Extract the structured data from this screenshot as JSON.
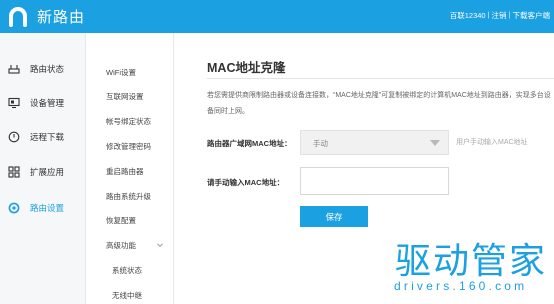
{
  "header": {
    "brand": "新路由",
    "links": [
      "百联12340",
      "注销",
      "下载客户端"
    ],
    "separator": "|",
    "accent": "#1ba0e2"
  },
  "sidebar": {
    "items": [
      {
        "label": "路由状态",
        "icon": "router-icon",
        "active": false
      },
      {
        "label": "设备管理",
        "icon": "monitor-icon",
        "active": false
      },
      {
        "label": "远程下载",
        "icon": "download-clock-icon",
        "active": false
      },
      {
        "label": "扩展应用",
        "icon": "apps-grid-icon",
        "active": false
      },
      {
        "label": "路由设置",
        "icon": "gear-icon",
        "active": true
      }
    ]
  },
  "submenu": {
    "items": [
      "WiFi设置",
      "互联网设置",
      "帐号绑定状态",
      "修改管理密码",
      "重启路由器",
      "路由系统升级",
      "恢复配置",
      "高级功能"
    ],
    "children": [
      "系统状态",
      "无线中继"
    ]
  },
  "main": {
    "title": "MAC地址克隆",
    "description": "若您需提供商限制路由器或设备连接数，“MAC地址克隆”可复制被绑定的计算机MAC地址到路由器，实现多台设备同时上网。",
    "wan_mac_label": "路由器广域网MAC地址：",
    "wan_mac_value": "手动",
    "wan_mac_hint": "用户手动输入MAC地址",
    "manual_mac_label": "请手动输入MAC地址：",
    "manual_mac_value": "",
    "save_label": "保存"
  },
  "watermark": {
    "title": "驱动管家",
    "url": "drivers.160.com"
  }
}
